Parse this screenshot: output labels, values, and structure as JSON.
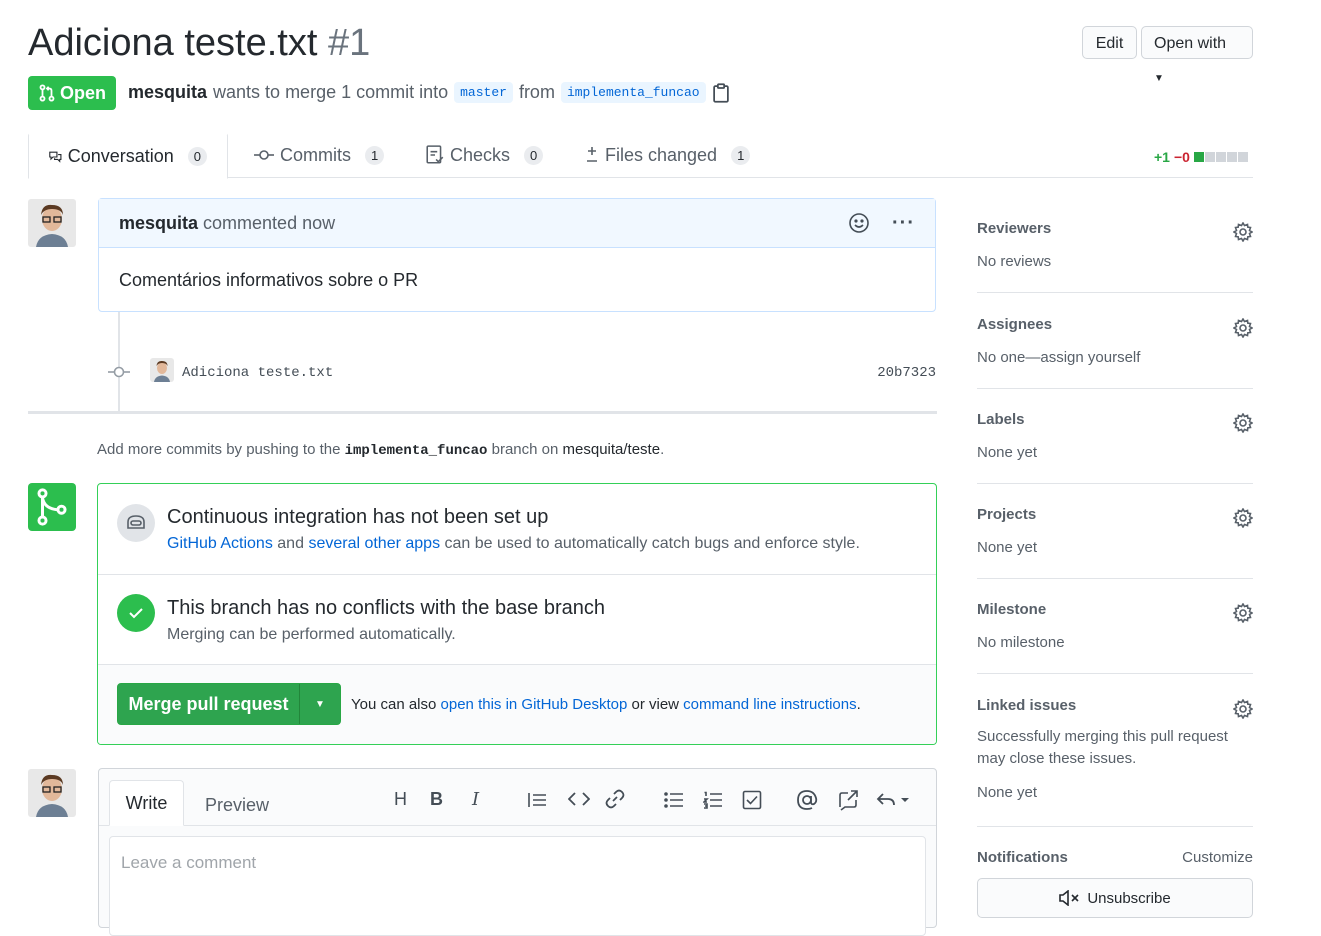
{
  "header": {
    "title": "Adiciona teste.txt",
    "number": "#1",
    "edit_label": "Edit",
    "open_with_label": "Open with",
    "state_label": "Open",
    "author": "mesquita",
    "merge_text": "wants to merge 1 commit into",
    "base_branch": "master",
    "from_text": "from",
    "head_branch": "implementa_funcao"
  },
  "tabs": [
    {
      "label": "Conversation",
      "count": "0",
      "icon": "comment-discussion-icon"
    },
    {
      "label": "Commits",
      "count": "1",
      "icon": "git-commit-icon"
    },
    {
      "label": "Checks",
      "count": "0",
      "icon": "checklist-icon"
    },
    {
      "label": "Files changed",
      "count": "1",
      "icon": "diff-icon"
    }
  ],
  "diffstat": {
    "additions": "+1",
    "deletions": "−0",
    "colors": {
      "add": "#28a745",
      "del": "#cb2431",
      "neutral": "#d1d5da"
    }
  },
  "comment": {
    "author": "mesquita",
    "action": "commented now",
    "body": "Comentários informativos sobre o PR"
  },
  "commit": {
    "message": "Adiciona teste.txt",
    "sha": "20b7323"
  },
  "hint": {
    "prefix": "Add more commits by pushing to the",
    "branch": "implementa_funcao",
    "middle": "branch on",
    "repo": "mesquita/teste",
    "suffix": "."
  },
  "merge": {
    "ci_title": "Continuous integration has not been set up",
    "ci_link1": "GitHub Actions",
    "ci_and": "and",
    "ci_link2": "several other apps",
    "ci_rest": "can be used to automatically catch bugs and enforce style.",
    "conflict_title": "This branch has no conflicts with the base branch",
    "conflict_sub": "Merging can be performed automatically.",
    "button_label": "Merge pull request",
    "also_text": "You can also",
    "desktop_link": "open this in GitHub Desktop",
    "or_view": "or view",
    "cli_link": "command line instructions",
    "period": "."
  },
  "editor": {
    "tab_write": "Write",
    "tab_preview": "Preview",
    "placeholder": "Leave a comment"
  },
  "sidebar": {
    "items": [
      {
        "title": "Reviewers",
        "value": "No reviews"
      },
      {
        "title": "Assignees",
        "value": "No one—assign yourself"
      },
      {
        "title": "Labels",
        "value": "None yet"
      },
      {
        "title": "Projects",
        "value": "None yet"
      },
      {
        "title": "Milestone",
        "value": "No milestone"
      },
      {
        "title": "Linked issues",
        "value": "Successfully merging this pull request may close these issues.",
        "value2": "None yet"
      }
    ],
    "notifications_title": "Notifications",
    "customize_label": "Customize",
    "unsubscribe_label": "Unsubscribe"
  }
}
